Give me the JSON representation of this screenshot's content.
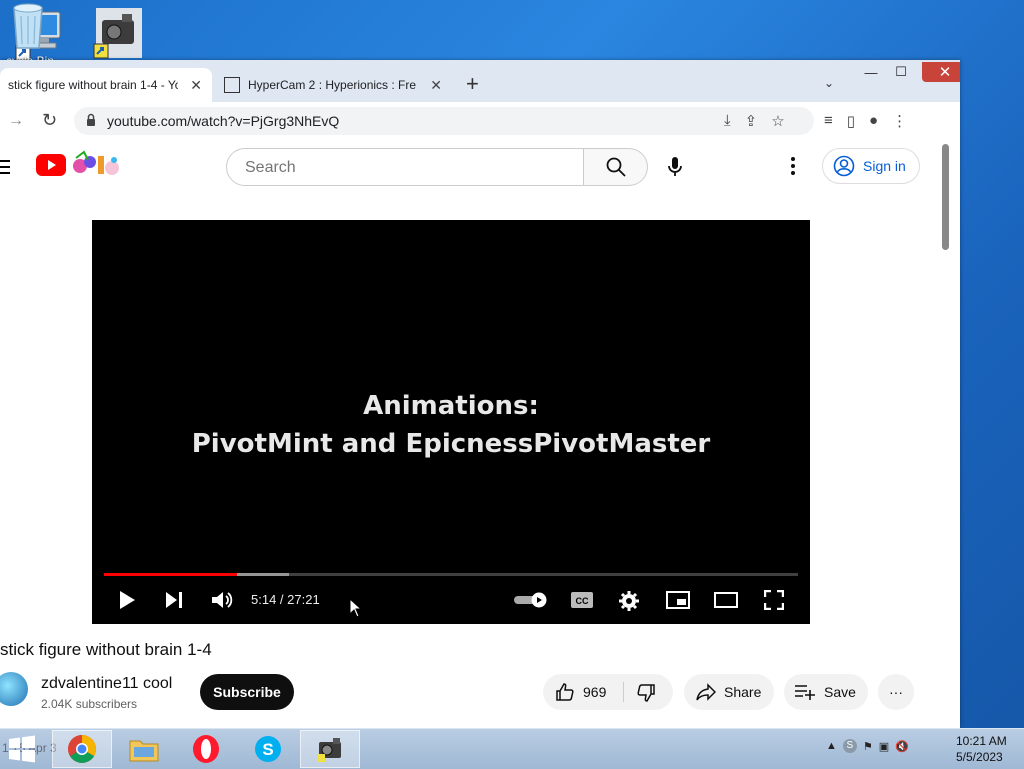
{
  "desktop": {
    "icons": [
      "computer-icon",
      "hypercam-icon"
    ],
    "recycle_bin_label": "cycle Bin"
  },
  "browser": {
    "tabs": [
      {
        "title": "stick figure without brain 1-4 - Yo",
        "close": "✕",
        "active": true
      },
      {
        "title": "HyperCam 2 : Hyperionics : Free",
        "close": "✕",
        "active": false
      }
    ],
    "new_tab": "+",
    "tab_search": "⌄",
    "window_controls": {
      "minimize": "—",
      "maximize": "☐",
      "close": "✕"
    },
    "url": "youtube.com/watch?v=PjGrg3NhEvQ"
  },
  "youtube": {
    "search_placeholder": "Search",
    "sign_in": "Sign in",
    "player": {
      "title_line1": "Animations:",
      "title_line2": "PivotMint and EpicnessPivotMaster",
      "time": "5:14 / 27:21",
      "progress_fraction": 0.191,
      "buffered_fraction": 0.267
    },
    "video_title": "stick figure without brain 1-4",
    "channel_name": "zdvalentine11 cool",
    "subscribers": "2.04K subscribers",
    "subscribe": "Subscribe",
    "likes": "969",
    "share": "Share",
    "save": "Save",
    "more": "···"
  },
  "taskbar": {
    "ghost_text": "1  75  Apr  3",
    "apps": [
      "chrome-icon",
      "explorer-icon",
      "opera-icon",
      "skype-icon",
      "hypercam-icon"
    ],
    "clock_time": "10:21 AM",
    "clock_date": "5/5/2023"
  },
  "colors": {
    "youtube_red": "#ff0000",
    "signin_blue": "#065fd4",
    "desktop_blue": "#1c6fc9"
  }
}
